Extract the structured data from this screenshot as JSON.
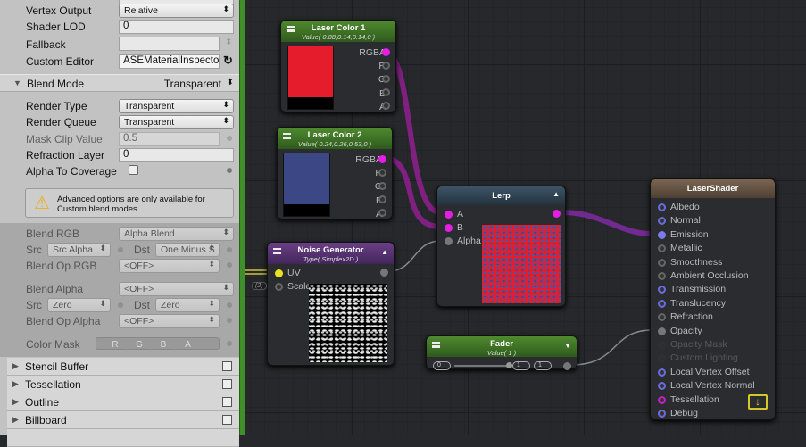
{
  "inspector": {
    "vertex_output": {
      "label": "Vertex Output",
      "value": "Relative"
    },
    "shader_lod": {
      "label": "Shader LOD",
      "value": "0"
    },
    "fallback": {
      "label": "Fallback",
      "value": ""
    },
    "custom_editor": {
      "label": "Custom Editor",
      "value": "ASEMaterialInspecto"
    },
    "blend_mode": {
      "label": "Blend Mode",
      "value": "Transparent"
    },
    "render_type": {
      "label": "Render Type",
      "value": "Transparent"
    },
    "render_queue": {
      "label": "Render Queue",
      "value": "Transparent"
    },
    "mask_clip": {
      "label": "Mask Clip Value",
      "value": "0.5"
    },
    "refraction_layer": {
      "label": "Refraction Layer",
      "value": "0"
    },
    "alpha_to_coverage": {
      "label": "Alpha To Coverage",
      "checked": false
    },
    "warning": "Advanced options are only available for Custom blend modes",
    "blend_rgb": {
      "label": "Blend RGB",
      "value": "Alpha Blend"
    },
    "src_rgb": {
      "label": "Src",
      "value": "Src Alpha"
    },
    "dst_rgb": {
      "label": "Dst",
      "value": "One Minus S"
    },
    "blend_op_rgb": {
      "label": "Blend Op RGB",
      "value": "<OFF>"
    },
    "blend_alpha": {
      "label": "Blend Alpha",
      "value": "<OFF>"
    },
    "src_alpha": {
      "label": "Src",
      "value": "Zero"
    },
    "dst_alpha": {
      "label": "Dst",
      "value": "Zero"
    },
    "blend_op_alpha": {
      "label": "Blend Op Alpha",
      "value": "<OFF>"
    },
    "color_mask": {
      "label": "Color Mask",
      "channels": [
        "R",
        "G",
        "B",
        "A"
      ]
    },
    "foldouts": [
      "Stencil Buffer",
      "Tessellation",
      "Outline",
      "Billboard"
    ]
  },
  "nodes": {
    "laser_color_1": {
      "title": "Laser Color 1",
      "subtitle": "Value( 0.88,0.14,0.14,0 )",
      "color": "#e51c2b",
      "outputs": [
        "RGBA",
        "R",
        "G",
        "B",
        "A"
      ]
    },
    "laser_color_2": {
      "title": "Laser Color 2",
      "subtitle": "Value( 0.24,0.26,0.53,0 )",
      "color": "#3c4785",
      "outputs": [
        "RGBA",
        "R",
        "G",
        "B",
        "A"
      ]
    },
    "lerp": {
      "title": "Lerp",
      "inputs": [
        "A",
        "B",
        "Alpha"
      ]
    },
    "noise": {
      "title": "Noise Generator",
      "subtitle": "Type( Simplex2D )",
      "inputs": [
        "UV",
        "Scale"
      ],
      "badge": "(2)"
    },
    "fader": {
      "title": "Fader",
      "subtitle": "Value( 1 )",
      "min": "0",
      "max": "1",
      "value": "1",
      "fraction": 1.0
    },
    "shader": {
      "title": "LaserShader",
      "inputs": [
        "Albedo",
        "Normal",
        "Emission",
        "Metallic",
        "Smoothness",
        "Ambient Occlusion",
        "Transmission",
        "Translucency",
        "Refraction",
        "Opacity",
        "Opacity Mask",
        "Custom Lighting",
        "Local Vertex Offset",
        "Local Vertex Normal",
        "Tessellation",
        "Debug"
      ]
    }
  }
}
